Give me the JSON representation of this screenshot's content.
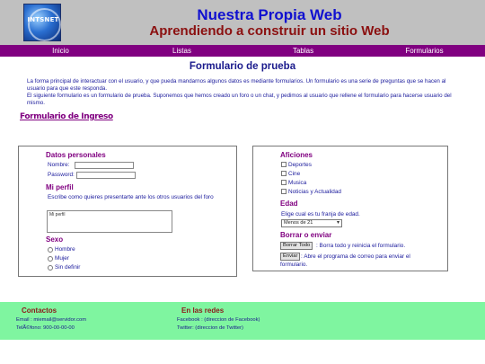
{
  "header": {
    "logo_text": "INTSNET",
    "title": "Nuestra Propia Web",
    "subtitle": "Aprendiendo a construir un sitio Web"
  },
  "nav": {
    "items": [
      "Inicio",
      "Listas",
      "Tablas",
      "Formularios"
    ]
  },
  "main": {
    "heading": "Formulario de prueba",
    "intro_1": "La forma principal de interactuar con el usuario, y que pueda mandarnos algunos datos es mediante formularios. Un formulario es una serie de preguntas que se hacen al usuario para que este responda.",
    "intro_2": "El siguiente formulario es un formulario de prueba. Suponemos que hemos creado un foro o un chat, y pedimos al usuario que rellene el formulario para hacerse usuario del mismo.",
    "section_title": "Formulario de Ingreso"
  },
  "form_left": {
    "personal_title": "Datos personales",
    "name_label": "Nombre:",
    "password_label": "Password:",
    "profile_title": "Mi perfil",
    "profile_desc": "Escribe como quieres presentarte ante los otros usuarios del foro",
    "profile_value": "Mi perfil",
    "sex_title": "Sexo",
    "sex_options": [
      "Hombre",
      "Mujer",
      "Sin definir"
    ]
  },
  "form_right": {
    "hobbies_title": "Aficiones",
    "hobbies": [
      "Deportes",
      "Cine",
      "Musica",
      "Noticias y Actualidad"
    ],
    "age_title": "Edad",
    "age_desc": "Elige cual es tu franja de edad.",
    "age_selected": "Menos de 21",
    "send_title": "Borrar o enviar",
    "reset_label": "Borrar Todo",
    "reset_desc": ": Borra todo y reinicia el formulario.",
    "submit_label": "Enviar",
    "submit_desc": ": Abre el programa de correo para enviar el",
    "submit_desc_2": "formulario."
  },
  "footer": {
    "contacts_title": "Contactos",
    "email_line": "Email : miemail@servidor.com",
    "phone_line": "TelÃ©fono: 900-00-00-00",
    "social_title": "En las redes",
    "facebook_line": "Facebook : (direccion de Facebook)",
    "twitter_line": "Twitter: (direccion de Twitter)"
  },
  "colors": {
    "header_bg": "#c0c0c0",
    "nav_bg": "#800080",
    "title": "#1010d0",
    "subtitle": "#8b1010",
    "footer_bg": "#7ff5a0"
  }
}
